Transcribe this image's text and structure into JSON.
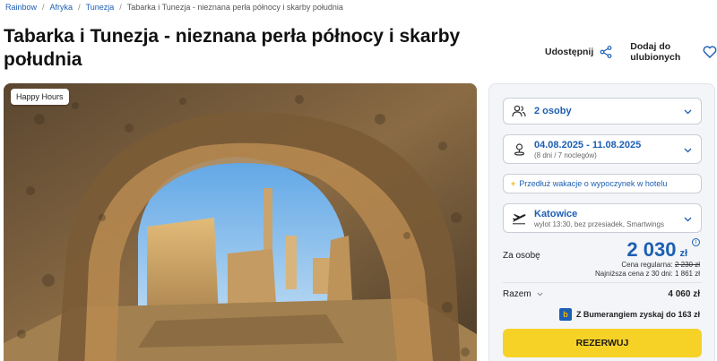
{
  "breadcrumb": {
    "items": [
      "Rainbow",
      "Afryka",
      "Tunezja"
    ],
    "current": "Tabarka i Tunezja - nieznana perła północy i skarby południa",
    "separator": "/"
  },
  "title": "Tabarka i Tunezja - nieznana perła północy i skarby południa",
  "actions": {
    "share": "Udostępnij",
    "favorite": "Dodaj do ulubionych"
  },
  "photo": {
    "badge": "Happy Hours"
  },
  "booking": {
    "persons": "2 osoby",
    "dates": "04.08.2025 - 11.08.2025",
    "dates_sub": "(8 dni / 7 noclegów)",
    "extend": "Przedłuż wakacje o wypoczynek w hotelu",
    "departure_city": "Katowice",
    "departure_sub": "wylot 13:30, bez przesiadek, Smartwings",
    "price_label": "Za osobę",
    "price": "2 030",
    "currency": "zł",
    "regular_label": "Cena regularna:",
    "regular_price": "2 230 zł",
    "lowest_label": "Najniższa cena z 30 dni:",
    "lowest_price": "1 861 zł",
    "total_label": "Razem",
    "total": "4 060 zł",
    "bumerang": "Z Bumerangiem zyskaj do 163 zł",
    "reserve": "REZERWUJ"
  },
  "colors": {
    "brand_blue": "#1c5fb3",
    "reserve_yellow": "#f6d227"
  }
}
